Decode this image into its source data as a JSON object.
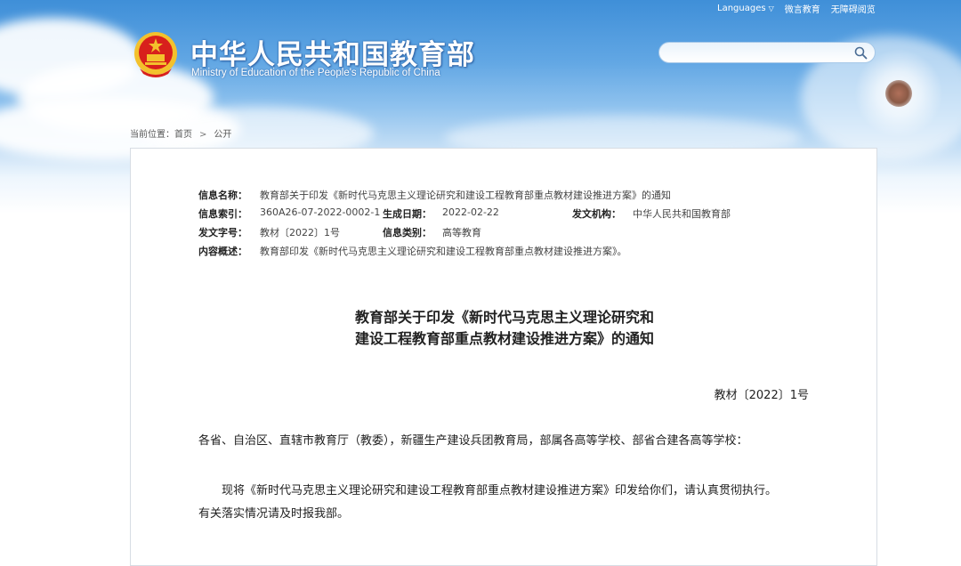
{
  "header": {
    "languages": "Languages",
    "links": [
      "微言教育",
      "无障碍阅览"
    ],
    "title_cn": "中华人民共和国教育部",
    "title_en": "Ministry of Education of the People's Republic of China"
  },
  "search": {
    "placeholder": ""
  },
  "breadcrumb": {
    "label": "当前位置：",
    "home": "首页",
    "current": "公开"
  },
  "meta": {
    "name_label": "信息名称：",
    "name_value": "教育部关于印发《新时代马克思主义理论研究和建设工程教育部重点教材建设推进方案》的通知",
    "index_label": "信息索引：",
    "index_value": "360A26-07-2022-0002-1",
    "date_label": "生成日期：",
    "date_value": "2022-02-22",
    "issuer_label": "发文机构：",
    "issuer_value": "中华人民共和国教育部",
    "docno_label": "发文字号：",
    "docno_value": "教材〔2022〕1号",
    "category_label": "信息类别：",
    "category_value": "高等教育",
    "summary_label": "内容概述：",
    "summary_value": "教育部印发《新时代马克思主义理论研究和建设工程教育部重点教材建设推进方案》。"
  },
  "document": {
    "title_line1": "教育部关于印发《新时代马克思主义理论研究和",
    "title_line2": "建设工程教育部重点教材建设推进方案》的通知",
    "number": "教材〔2022〕1号",
    "salutation": "各省、自治区、直辖市教育厅（教委），新疆生产建设兵团教育局，部属各高等学校、部省合建各高等学校：",
    "body_line1": "现将《新时代马克思主义理论研究和建设工程教育部重点教材建设推进方案》印发给你们，请认真贯彻执行。",
    "body_line2": "有关落实情况请及时报我部。"
  },
  "icons": {
    "emblem": "national-emblem-icon",
    "search": "search-icon",
    "chevron": "chevron-down-icon"
  },
  "colors": {
    "sky_top": "#3f8fd8",
    "emblem_red": "#d8201c",
    "emblem_gold": "#f3c12c"
  }
}
